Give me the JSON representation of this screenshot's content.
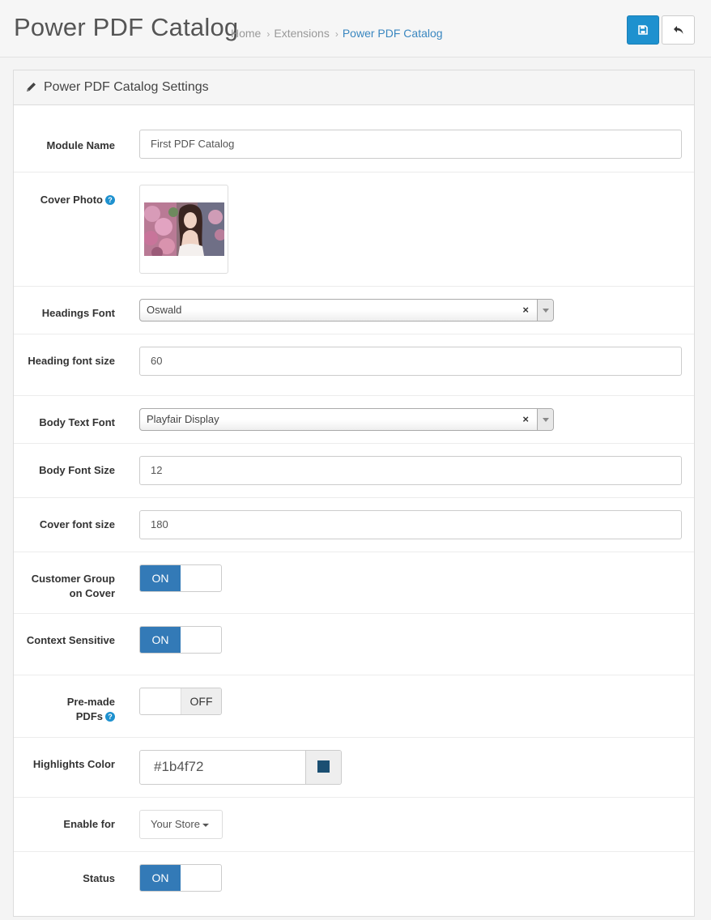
{
  "header": {
    "title": "Power PDF Catalog",
    "breadcrumb": [
      "Home",
      "Extensions",
      "Power PDF Catalog"
    ],
    "save_icon": "save-icon",
    "back_icon": "reply-icon",
    "accent_color": "#1e91cf"
  },
  "panel": {
    "title": "Power PDF Catalog Settings",
    "icon": "pencil-icon"
  },
  "form": {
    "module_name": {
      "label": "Module Name",
      "value": "First PDF Catalog"
    },
    "cover_photo": {
      "label": "Cover Photo",
      "help": "?"
    },
    "headings_font": {
      "label": "Headings Font",
      "value": "Oswald",
      "clear": "×"
    },
    "heading_font_size": {
      "label": "Heading font size",
      "value": "60"
    },
    "body_text_font": {
      "label": "Body Text Font",
      "value": "Playfair Display",
      "clear": "×"
    },
    "body_font_size": {
      "label": "Body Font Size",
      "value": "12"
    },
    "cover_font_size": {
      "label": "Cover font size",
      "value": "180"
    },
    "customer_group_on_cover": {
      "label": "Customer Group on Cover",
      "state": "ON"
    },
    "context_sensitive": {
      "label": "Context Sensitive",
      "state": "ON"
    },
    "pre_made_pdfs": {
      "label": "Pre-made PDFs",
      "help": "?",
      "state": "OFF"
    },
    "highlights_color": {
      "label": "Highlights Color",
      "value": "#1b4f72",
      "swatch": "#1b4f72"
    },
    "enable_for": {
      "label": "Enable for",
      "value": "Your Store"
    },
    "status": {
      "label": "Status",
      "state": "ON"
    }
  }
}
